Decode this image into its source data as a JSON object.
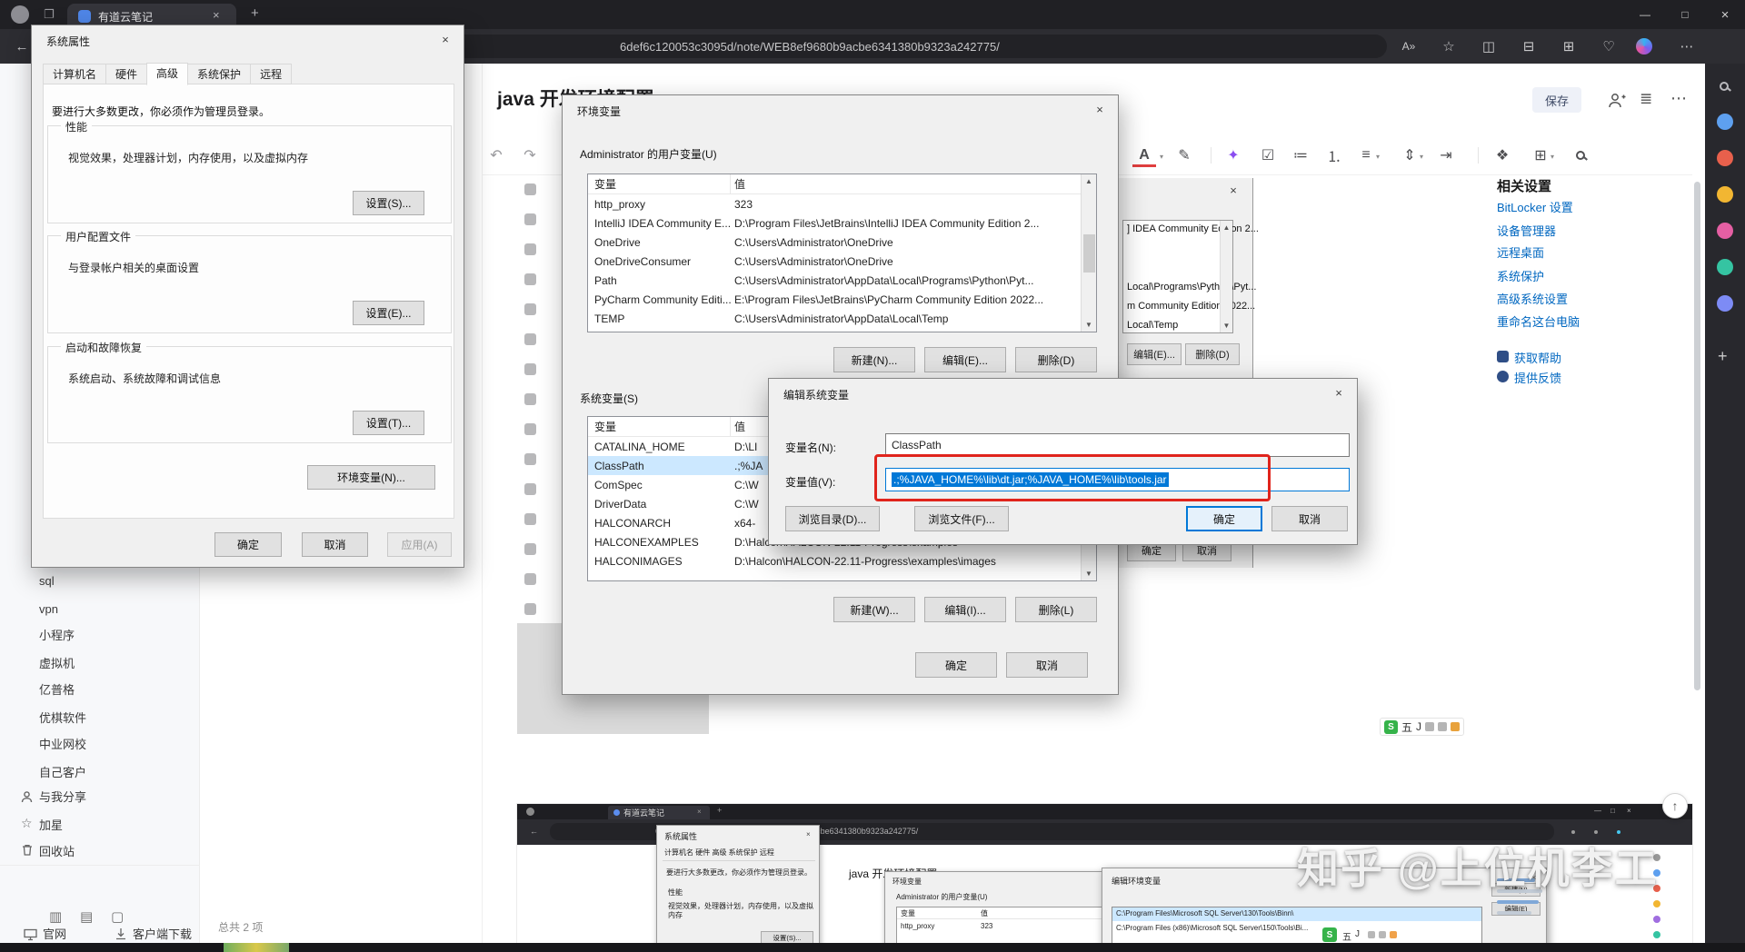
{
  "colors": {
    "accent_blue": "#0078d7",
    "link_blue": "#0067c0",
    "annotation_red": "#e0241c",
    "sogou_green": "#36b34a"
  },
  "window": {
    "min": "—",
    "max": "□",
    "close": "×"
  },
  "browser": {
    "tab_title": "有道云笔记",
    "url": "6def6c120053c3095d/note/WEB8ef9680b9acbe6341380b9323a242775/"
  },
  "tb": {
    "back": "←",
    "plus": "+",
    "tab_close": "×",
    "read_aloud": "A»",
    "favorite": "☆",
    "split": "◫",
    "favorites_bar": "⊟",
    "collections": "⊞",
    "essentials": "♡",
    "more": "⋯"
  },
  "misc": {
    "up": "↑",
    "scroll_up": "▲",
    "scroll_down": "▼",
    "caret": "▾",
    "star": "☆",
    "edge_plus": "+"
  },
  "sidebar": {
    "items": [
      "sql",
      "vpn",
      "小程序",
      "虚拟机",
      "亿普格",
      "优棋软件",
      "中业网校",
      "自己客户"
    ],
    "shared": "与我分享",
    "starred": "加星",
    "trash": "回收站",
    "official": "官网",
    "download": "客户端下载",
    "count": "总共 2 项"
  },
  "note": {
    "title": "java 开发环境配置",
    "save": "保存"
  },
  "editor": {
    "undo": "↶",
    "redo": "↷",
    "font": "A",
    "highlight": "✎",
    "ai": "✦",
    "todo": "☑",
    "bullet": "≔",
    "ordered": "⒈",
    "align": "≡",
    "spacing": "⇕",
    "indent": "⇥",
    "wand": "❖",
    "table": "⊞"
  },
  "related": {
    "title": "相关设置",
    "links": [
      "BitLocker 设置",
      "设备管理器",
      "远程桌面",
      "系统保护",
      "高级系统设置",
      "重命名这台电脑"
    ],
    "help": "获取帮助",
    "feedback": "提供反馈"
  },
  "sysprops": {
    "title": "系统属性",
    "tabs": [
      "计算机名",
      "硬件",
      "高级",
      "系统保护",
      "远程"
    ],
    "admin_note": "要进行大多数更改，你必须作为管理员登录。",
    "perf_title": "性能",
    "perf_desc": "视觉效果，处理器计划，内存使用，以及虚拟内存",
    "perf_btn": "设置(S)...",
    "profile_title": "用户配置文件",
    "profile_desc": "与登录帐户相关的桌面设置",
    "profile_btn": "设置(E)...",
    "startup_title": "启动和故障恢复",
    "startup_desc": "系统启动、系统故障和调试信息",
    "startup_btn": "设置(T)...",
    "env_btn": "环境变量(N)...",
    "ok": "确定",
    "cancel": "取消",
    "apply": "应用(A)"
  },
  "envvars": {
    "title": "环境变量",
    "user_label": "Administrator 的用户变量(U)",
    "col_var": "变量",
    "col_val": "值",
    "user_rows": [
      {
        "name": "http_proxy",
        "value": "323"
      },
      {
        "name": "IntelliJ IDEA Community E...",
        "value": "D:\\Program Files\\JetBrains\\IntelliJ IDEA Community Edition 2..."
      },
      {
        "name": "OneDrive",
        "value": "C:\\Users\\Administrator\\OneDrive"
      },
      {
        "name": "OneDriveConsumer",
        "value": "C:\\Users\\Administrator\\OneDrive"
      },
      {
        "name": "Path",
        "value": "C:\\Users\\Administrator\\AppData\\Local\\Programs\\Python\\Pyt..."
      },
      {
        "name": "PyCharm Community Editi...",
        "value": "E:\\Program Files\\JetBrains\\PyCharm Community Edition 2022..."
      },
      {
        "name": "TEMP",
        "value": "C:\\Users\\Administrator\\AppData\\Local\\Temp"
      }
    ],
    "user_new": "新建(N)...",
    "user_edit": "编辑(E)...",
    "user_del": "删除(D)",
    "sys_label": "系统变量(S)",
    "sys_rows": [
      {
        "name": "CATALINA_HOME",
        "value": "D:\\LI"
      },
      {
        "name": "ClassPath",
        "value": ".;%JA"
      },
      {
        "name": "ComSpec",
        "value": "C:\\W"
      },
      {
        "name": "DriverData",
        "value": "C:\\W"
      },
      {
        "name": "HALCONARCH",
        "value": "x64-"
      },
      {
        "name": "HALCONEXAMPLES",
        "value": "D:\\Halcon\\HALCON-22.11-Progress\\examples"
      },
      {
        "name": "HALCONIMAGES",
        "value": "D:\\Halcon\\HALCON-22.11-Progress\\examples\\images"
      }
    ],
    "sys_new": "新建(W)...",
    "sys_edit": "编辑(I)...",
    "sys_del": "删除(L)",
    "ok": "确定",
    "cancel": "取消"
  },
  "editvar": {
    "title": "编辑系统变量",
    "name_label": "变量名(N):",
    "name_value": "ClassPath",
    "value_label": "变量值(V):",
    "value_value": ".;%JAVA_HOME%\\lib\\dt.jar;%JAVA_HOME%\\lib\\tools.jar",
    "browse_dir": "浏览目录(D)...",
    "browse_file": "浏览文件(F)...",
    "ok": "确定",
    "cancel": "取消"
  },
  "fragment": {
    "rows": [
      "] IDEA Community Edition 2...",
      "Local\\Programs\\Python\\Pyt...",
      "m Community Edition 2022...",
      "Local\\Temp"
    ],
    "edit": "编辑(E)...",
    "del": "删除(D)",
    "ok": "确定",
    "cancel": "取消"
  },
  "sogou": {
    "logo": "S",
    "mode": "五",
    "letter": "J"
  },
  "watermark": "知乎 @上位机李工",
  "mini": {
    "tab_title": "有道云笔记",
    "url": "6def6c120053c3095d/note/WEB8ef9680b9acbe6341380b9323a242775/",
    "note_title": "java 开发环境配置",
    "sysprops_title": "系统属性",
    "sysprops_tabs": "计算机名  硬件  高级  系统保护  远程",
    "admin_note": "要进行大多数更改，你必须作为管理员登录。",
    "perf": "性能",
    "perf_desc": "视觉效果，处理器计划，内存使用，以及虚拟内存",
    "settings_btn": "设置(S)...",
    "env_title": "环境变量",
    "user_label": "Administrator 的用户变量(U)",
    "col_var": "变量",
    "col_val": "值",
    "row_name": "http_proxy",
    "row_val": "323",
    "edit_title": "编辑环境变量",
    "row1": "C:\\Program Files\\Microsoft SQL Server\\130\\Tools\\Binn\\",
    "row2": "C:\\Program Files (x86)\\Microsoft SQL Server\\150\\Tools\\Bi...",
    "btn_new": "新建(N)",
    "btn_edit": "编辑(E)"
  }
}
